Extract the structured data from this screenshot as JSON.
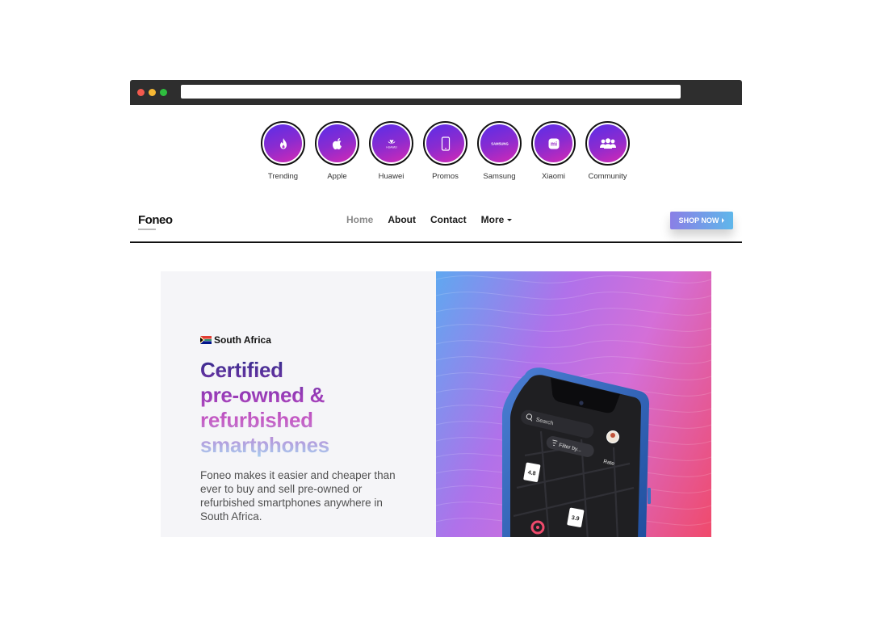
{
  "stories": [
    {
      "label": "Trending",
      "icon": "flame-icon"
    },
    {
      "label": "Apple",
      "icon": "apple-icon"
    },
    {
      "label": "Huawei",
      "icon": "huawei-icon",
      "logo_text": "HUAWEI"
    },
    {
      "label": "Promos",
      "icon": "phone-icon"
    },
    {
      "label": "Samsung",
      "icon": "samsung-icon",
      "logo_text": "SAMSUNG"
    },
    {
      "label": "Xiaomi",
      "icon": "xiaomi-icon",
      "logo_text": "mi"
    },
    {
      "label": "Community",
      "icon": "people-icon"
    }
  ],
  "nav": {
    "logo": "Foneo",
    "links": [
      "Home",
      "About",
      "Contact",
      "More"
    ],
    "active": "Home",
    "cta": "SHOP NOW"
  },
  "hero": {
    "country": "South Africa",
    "headline_lines": [
      "Certified",
      "pre-owned &",
      "refurbished",
      "smartphones"
    ],
    "description": "Foneo makes it easier and cheaper than ever to buy and sell pre-owned or refurbished smartphones anywhere in South Africa."
  },
  "phone_screen": {
    "search_placeholder": "Search",
    "filter_label": "Filter by...",
    "rate_label": "Rate",
    "pins": [
      "4.8",
      "3.9"
    ]
  },
  "colors": {
    "chrome": "#2e2e2e",
    "brand_gradient_start": "#5a2ee8",
    "brand_gradient_end": "#d42ab4",
    "cta_start": "#8a7fe6",
    "cta_end": "#5fb7ea"
  }
}
